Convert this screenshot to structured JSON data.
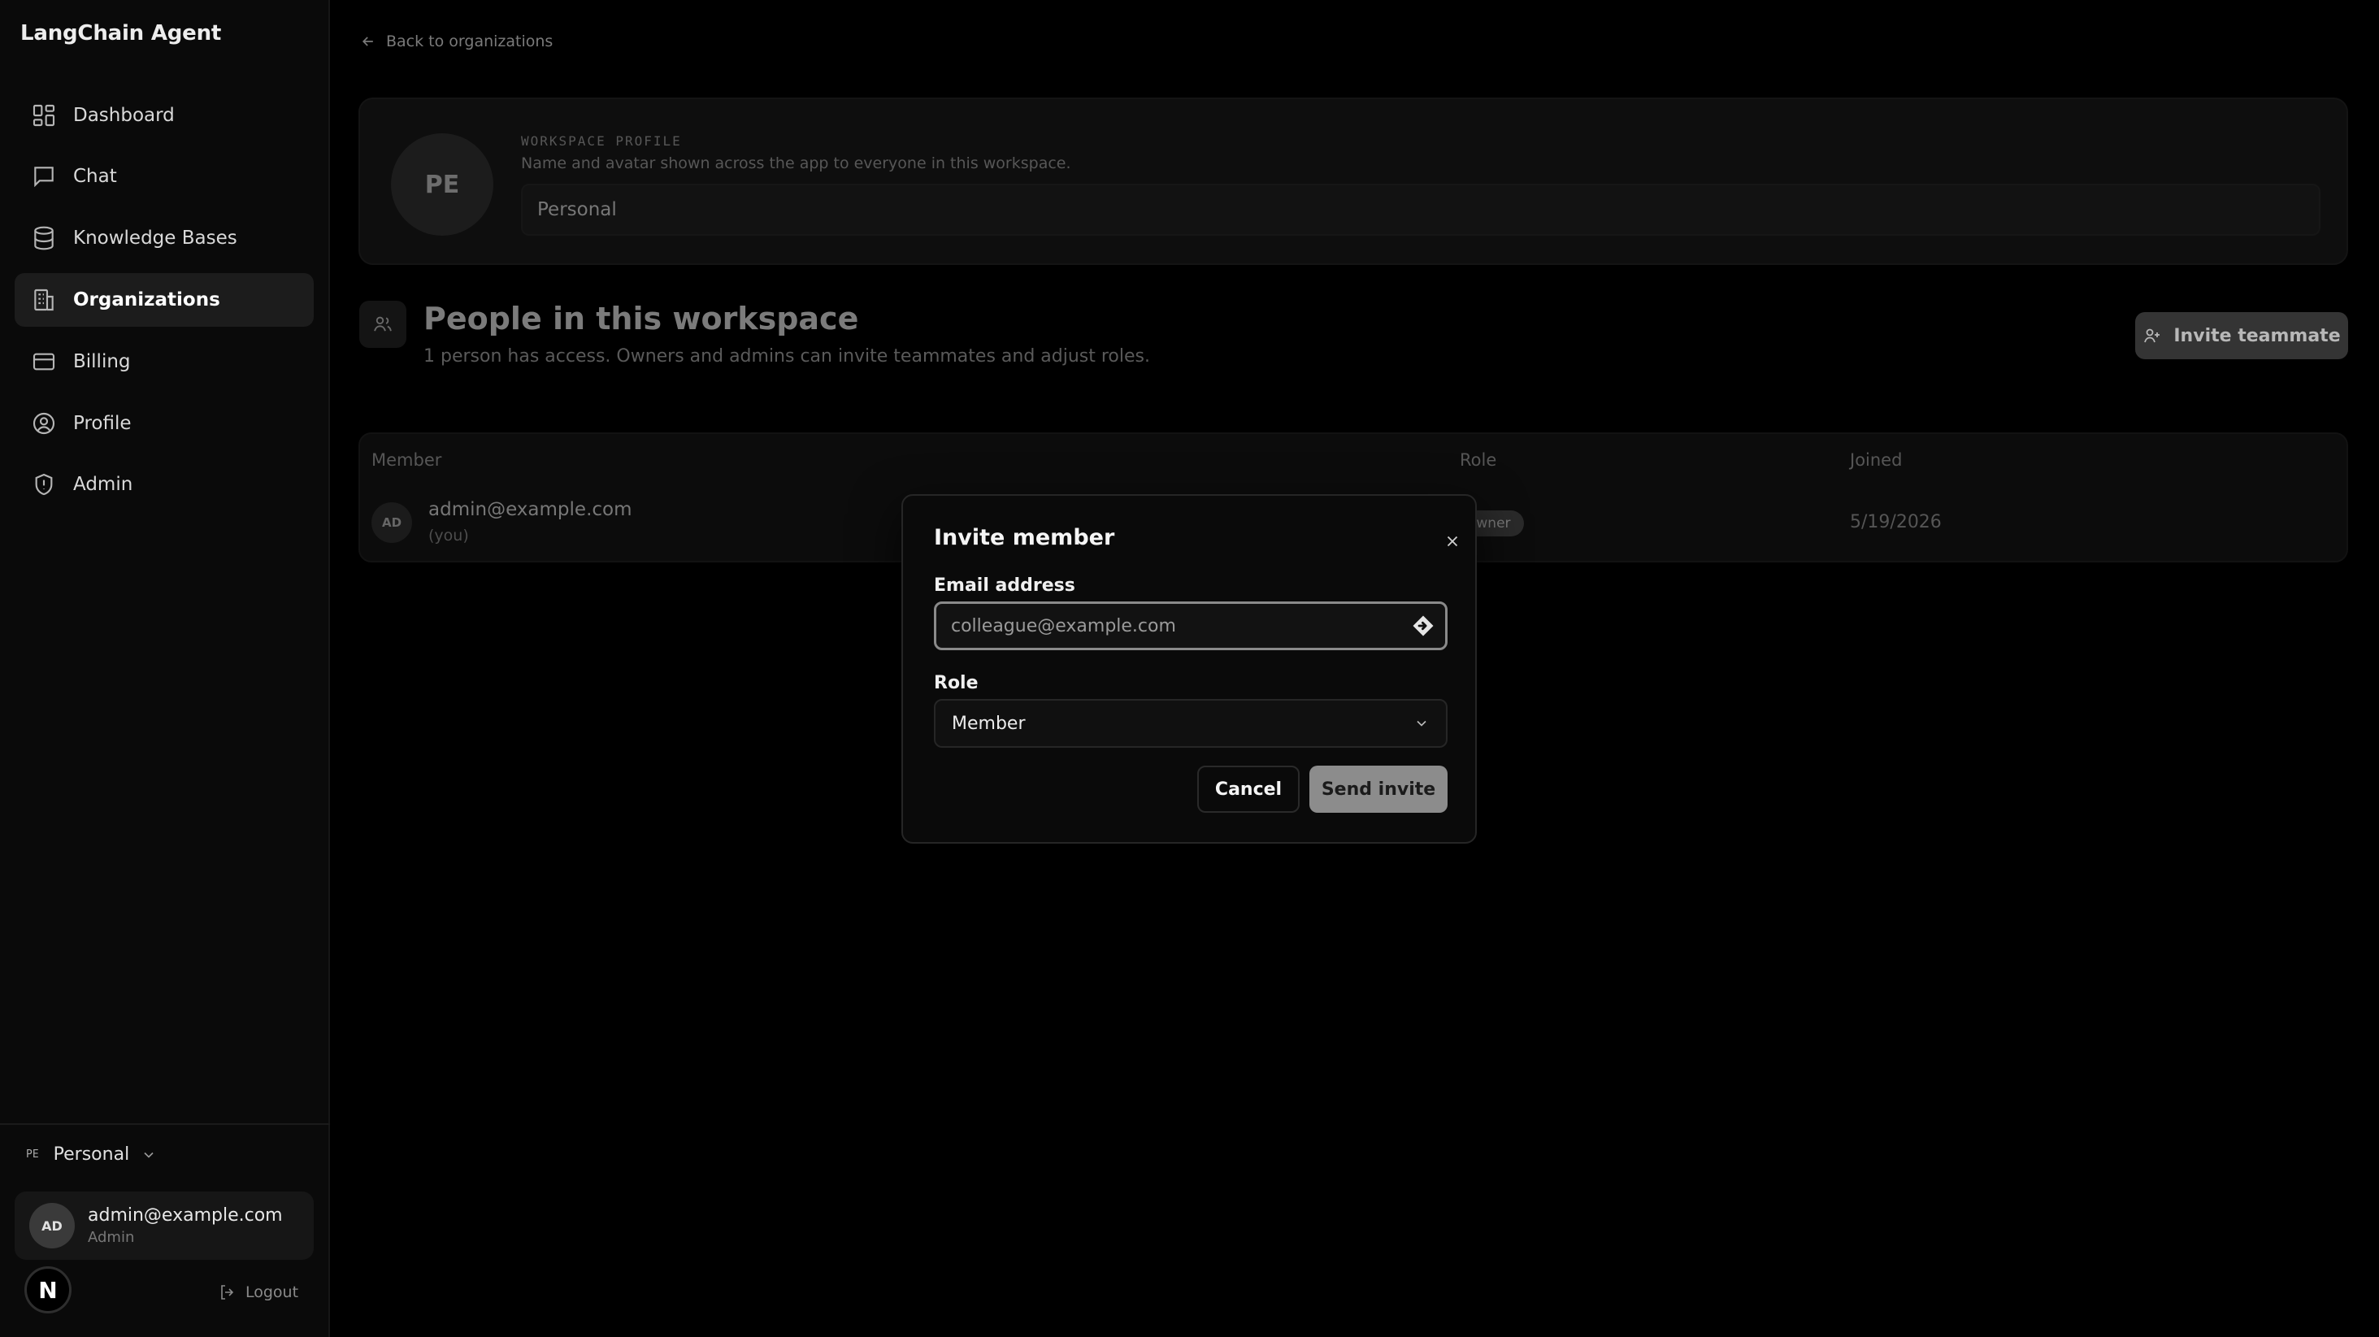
{
  "app": {
    "title": "LangChain Agent"
  },
  "sidebar": {
    "items": [
      {
        "label": "Dashboard",
        "icon": "grid-icon"
      },
      {
        "label": "Chat",
        "icon": "chat-icon"
      },
      {
        "label": "Knowledge Bases",
        "icon": "database-icon"
      },
      {
        "label": "Organizations",
        "icon": "building-icon",
        "active": true
      },
      {
        "label": "Billing",
        "icon": "card-icon"
      },
      {
        "label": "Profile",
        "icon": "user-circle-icon"
      },
      {
        "label": "Admin",
        "icon": "shield-icon"
      }
    ],
    "workspace_switcher": {
      "badge": "PE",
      "name": "Personal"
    },
    "user": {
      "initials": "AD",
      "email": "admin@example.com",
      "role": "Admin"
    },
    "logo_letter": "N",
    "logout_label": "Logout"
  },
  "main": {
    "back_link": "Back to organizations",
    "profile": {
      "avatar_initials": "PE",
      "kicker": "WORKSPACE PROFILE",
      "description": "Name and avatar shown across the app to everyone in this workspace.",
      "name_value": "Personal"
    },
    "people": {
      "title": "People in this workspace",
      "subtitle": "1 person has access. Owners and admins can invite teammates and adjust roles.",
      "invite_button": "Invite teammate"
    },
    "table": {
      "columns": [
        "Member",
        "Role",
        "Joined"
      ],
      "rows": [
        {
          "initials": "AD",
          "email": "admin@example.com",
          "note": "(you)",
          "role": "owner",
          "joined": "5/19/2026"
        }
      ]
    }
  },
  "modal": {
    "title": "Invite member",
    "email_label": "Email address",
    "email_placeholder": "colleague@example.com",
    "email_value": "",
    "role_label": "Role",
    "role_selected": "Member",
    "cancel_label": "Cancel",
    "submit_label": "Send invite"
  },
  "colors": {
    "background": "#000000",
    "sidebar": "#0a0a0a",
    "modal": "#0a0a0a",
    "primary_button": "#8c8c8c",
    "text": "#f2f2f2"
  }
}
